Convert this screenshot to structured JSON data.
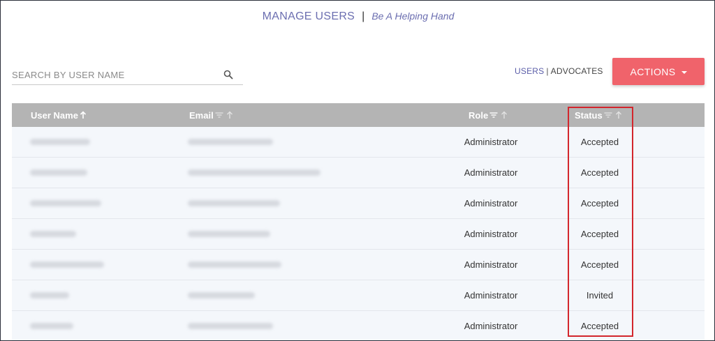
{
  "header": {
    "title": "MANAGE USERS",
    "separator": "|",
    "tagline": "Be A Helping Hand"
  },
  "search": {
    "placeholder": "SEARCH BY USER NAME",
    "value": "",
    "icon": "search-icon"
  },
  "view_switch": {
    "users_label": "USERS",
    "separator": "|",
    "advocates_label": "ADVOCATES",
    "active": "USERS"
  },
  "actions_button": {
    "label": "ACTIONS",
    "color": "#f0636b"
  },
  "table": {
    "columns": [
      {
        "label": "User Name"
      },
      {
        "label": "Email"
      },
      {
        "label": "Role"
      },
      {
        "label": "Status"
      }
    ],
    "rows": [
      {
        "role": "Administrator",
        "status": "Accepted"
      },
      {
        "role": "Administrator",
        "status": "Accepted"
      },
      {
        "role": "Administrator",
        "status": "Accepted"
      },
      {
        "role": "Administrator",
        "status": "Accepted"
      },
      {
        "role": "Administrator",
        "status": "Accepted"
      },
      {
        "role": "Administrator",
        "status": "Invited"
      },
      {
        "role": "Administrator",
        "status": "Accepted"
      }
    ],
    "header_color": "#b4b4b4",
    "row_color": "#f4f7fb"
  },
  "highlight": {
    "color": "#d3262c"
  }
}
